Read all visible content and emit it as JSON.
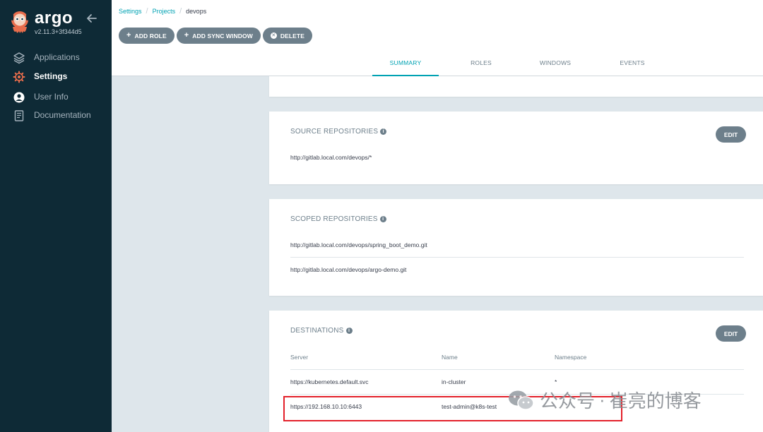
{
  "app": {
    "name": "argo",
    "version": "v2.11.3+3f344d5"
  },
  "sidebar": {
    "items": [
      {
        "label": "Applications",
        "icon": "layers-icon",
        "active": false
      },
      {
        "label": "Settings",
        "icon": "gear-icon",
        "active": true
      },
      {
        "label": "User Info",
        "icon": "user-circle-icon",
        "active": false
      },
      {
        "label": "Documentation",
        "icon": "book-icon",
        "active": false
      }
    ]
  },
  "breadcrumb": {
    "items": [
      "Settings",
      "Projects"
    ],
    "current": "devops"
  },
  "toolbar": {
    "add_role": "ADD ROLE",
    "add_sync_window": "ADD SYNC WINDOW",
    "delete": "DELETE"
  },
  "tabs": [
    "SUMMARY",
    "ROLES",
    "WINDOWS",
    "EVENTS"
  ],
  "active_tab": "SUMMARY",
  "source_repositories": {
    "title": "SOURCE REPOSITORIES",
    "edit_label": "EDIT",
    "items": [
      "http://gitlab.local.com/devops/*"
    ]
  },
  "scoped_repositories": {
    "title": "SCOPED REPOSITORIES",
    "items": [
      "http://gitlab.local.com/devops/spring_boot_demo.git",
      "http://gitlab.local.com/devops/argo-demo.git"
    ]
  },
  "destinations": {
    "title": "DESTINATIONS",
    "edit_label": "EDIT",
    "columns": [
      "Server",
      "Name",
      "Namespace"
    ],
    "rows": [
      {
        "server": "https://kubernetes.default.svc",
        "name": "in-cluster",
        "namespace": "*"
      },
      {
        "server": "https://192.168.10.10:6443",
        "name": "test-admin@k8s-test",
        "namespace": ""
      }
    ]
  },
  "watermark": {
    "left": "公众号",
    "right": "崔亮的博客"
  },
  "colors": {
    "sidebar_bg": "#0e2a36",
    "accent": "#00a2b3",
    "button_grey": "#6d7f8b",
    "highlight_red": "#e3202a",
    "page_bg": "#dee6eb"
  }
}
